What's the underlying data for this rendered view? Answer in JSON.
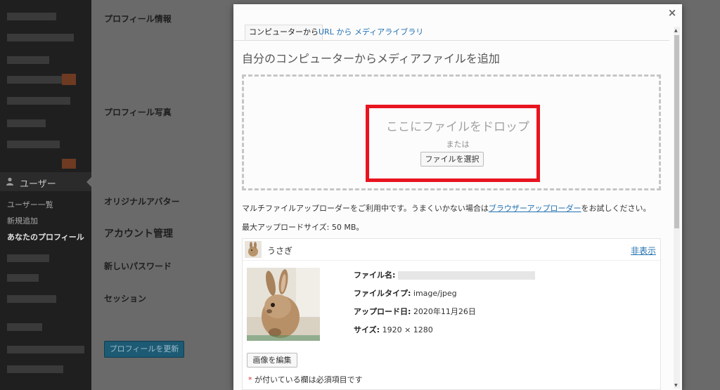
{
  "sidebar": {
    "users_menu_label": "ユーザー",
    "submenu": [
      "ユーザー一覧",
      "新規追加",
      "あなたのプロフィール"
    ]
  },
  "profile": {
    "profile_info_label": "プロフィール情報",
    "profile_photo_label": "プロフィール写真",
    "original_avatar_label": "オリジナルアバター",
    "account_management_title": "アカウント管理",
    "new_password_label": "新しいパスワード",
    "session_label": "セッション",
    "update_button": "プロフィールを更新"
  },
  "modal": {
    "close_glyph": "×",
    "tabs": [
      "コンピューターから",
      "URL から",
      "メディアライブラリ"
    ],
    "active_tab": 0,
    "heading": "自分のコンピューターからメディアファイルを追加",
    "drop_instructions": "ここにファイルをドロップ",
    "or_text": "または",
    "select_files_button": "ファイルを選択",
    "uploader_note_before": "マルチファイルアップローダーをご利用中です。うまくいかない場合は",
    "uploader_note_link": "ブラウザーアップローダー",
    "uploader_note_after": "をお試しください。",
    "max_size": "最大アップロードサイズ: 50 MB。",
    "item": {
      "title": "うさぎ",
      "hide_link": "非表示",
      "file_name_label": "ファイル名:",
      "file_type_label": "ファイルタイプ:",
      "file_type_value": "image/jpeg",
      "upload_date_label": "アップロード日:",
      "upload_date_value": "2020年11月26日",
      "size_label": "サイズ:",
      "size_value": "1920 × 1280",
      "edit_image_button": "画像を編集",
      "required_star": "*",
      "required_note": " が付いている欄は必須項目です"
    }
  },
  "colors": {
    "highlight": "#e8141f",
    "link": "#2271b1",
    "primary_button": "#1d5a73"
  }
}
